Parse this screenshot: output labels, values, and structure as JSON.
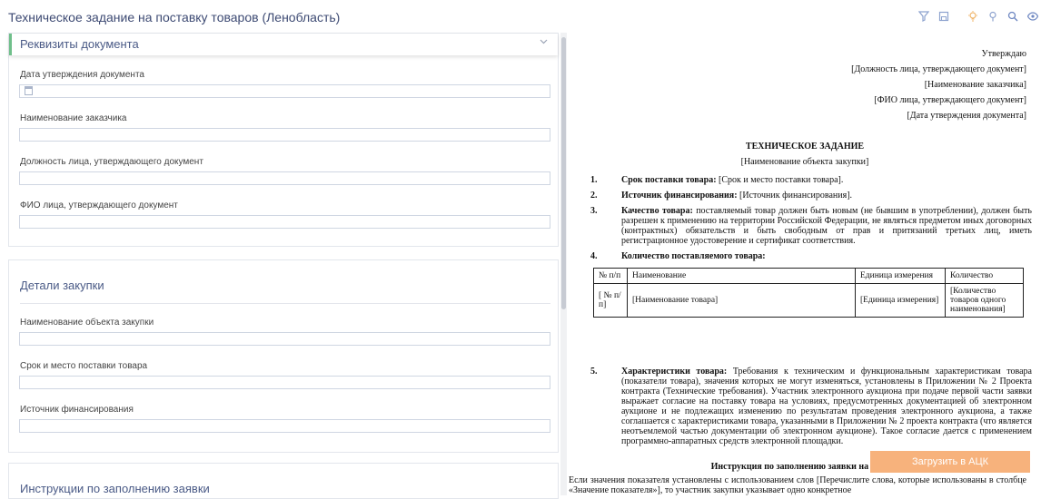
{
  "window": {
    "title": "Техническое задание на поставку товаров (Ленобласть)"
  },
  "toolbar": {
    "icons": [
      "filter-icon",
      "save-icon",
      "bulb-icon",
      "pin-icon",
      "zoom-icon",
      "eye-icon"
    ]
  },
  "sections": {
    "requisites": {
      "title": "Реквизиты документа",
      "fields": [
        {
          "label": "Дата утверждения документа",
          "value": ""
        },
        {
          "label": "Наименование заказчика",
          "value": ""
        },
        {
          "label": "Должность лица, утверждающего документ",
          "value": ""
        },
        {
          "label": "ФИО лица, утверждающего документ",
          "value": ""
        }
      ]
    },
    "purchase": {
      "title": "Детали закупки",
      "fields": [
        {
          "label": "Наименование объекта закупки",
          "value": ""
        },
        {
          "label": "Срок и место поставки товара",
          "value": ""
        },
        {
          "label": "Источник финансирования",
          "value": ""
        }
      ]
    },
    "instructions": {
      "title": "Инструкции по заполнению заявки"
    }
  },
  "document": {
    "approve": [
      "Утверждаю",
      "[Должность лица, утверждающего документ]",
      "[Наименование заказчика]",
      "[ФИО лица, утверждающего документ]",
      "[Дата утверждения документа]"
    ],
    "heading": "ТЕХНИЧЕСКОЕ ЗАДАНИЕ",
    "subheading": "[Наименование объекта закупки]",
    "items": [
      {
        "num": "1.",
        "label": "Срок поставки товара:",
        "text": " [Срок и место поставки товара]."
      },
      {
        "num": "2.",
        "label": "Источник финансирования:",
        "text": " [Источник финансирования]."
      },
      {
        "num": "3.",
        "label": "Качество товара:",
        "text": " поставляемый товар должен быть новым (не бывшим в употреблении), должен быть разрешен к применению на территории Российской Федерации, не являться предметом иных договорных (контрактных) обязательств и быть свободным от прав и притязаний третьих лиц, иметь регистрационное удостоверение и сертификат соответствия."
      },
      {
        "num": "4.",
        "label": "Количество поставляемого товара:",
        "text": ""
      },
      {
        "num": "5.",
        "label": "Характеристики товара:",
        "text": " Требования к техническим и функциональным характеристикам товара (показатели товара), значения которых не могут изменяться, установлены в Приложении № 2 Проекта контракта (Технические требования). Участник электронного аукциона при подаче первой части заявки выражает согласие на поставку товара на условиях, предусмотренных документацией об электронном аукционе и не подлежащих изменению по результатам проведения электронного аукциона, а также соглашается с характеристиками товара, указанными в Приложении № 2 проекта контракта (что является неотъемлемой частью документации об электронном аукционе). Такое согласие дается с применением программно-аппаратных средств электронной площадки."
      }
    ],
    "table": {
      "headers": [
        "№ п/п",
        "Наименование",
        "Единица измерения",
        "Количество"
      ],
      "row": [
        "[ № п/п]",
        "[Наименование товара]",
        "[Единица измерения]",
        "[Количество товаров одного наименования]"
      ]
    },
    "instructions_heading": "Инструкция по заполнению заявки на участи",
    "instructions_text": "Если значения показателя установлены с использованием слов [Перечислите слова, которые использованы в столбце «Значение показателя»], то участник закупки указывает одно конкретное"
  },
  "actions": {
    "upload_label": "Загрузить в АЦК"
  },
  "colors": {
    "accent_green": "#6fbf8a",
    "title_blue": "#3d4a73",
    "upload_orange": "#f7b27c"
  }
}
